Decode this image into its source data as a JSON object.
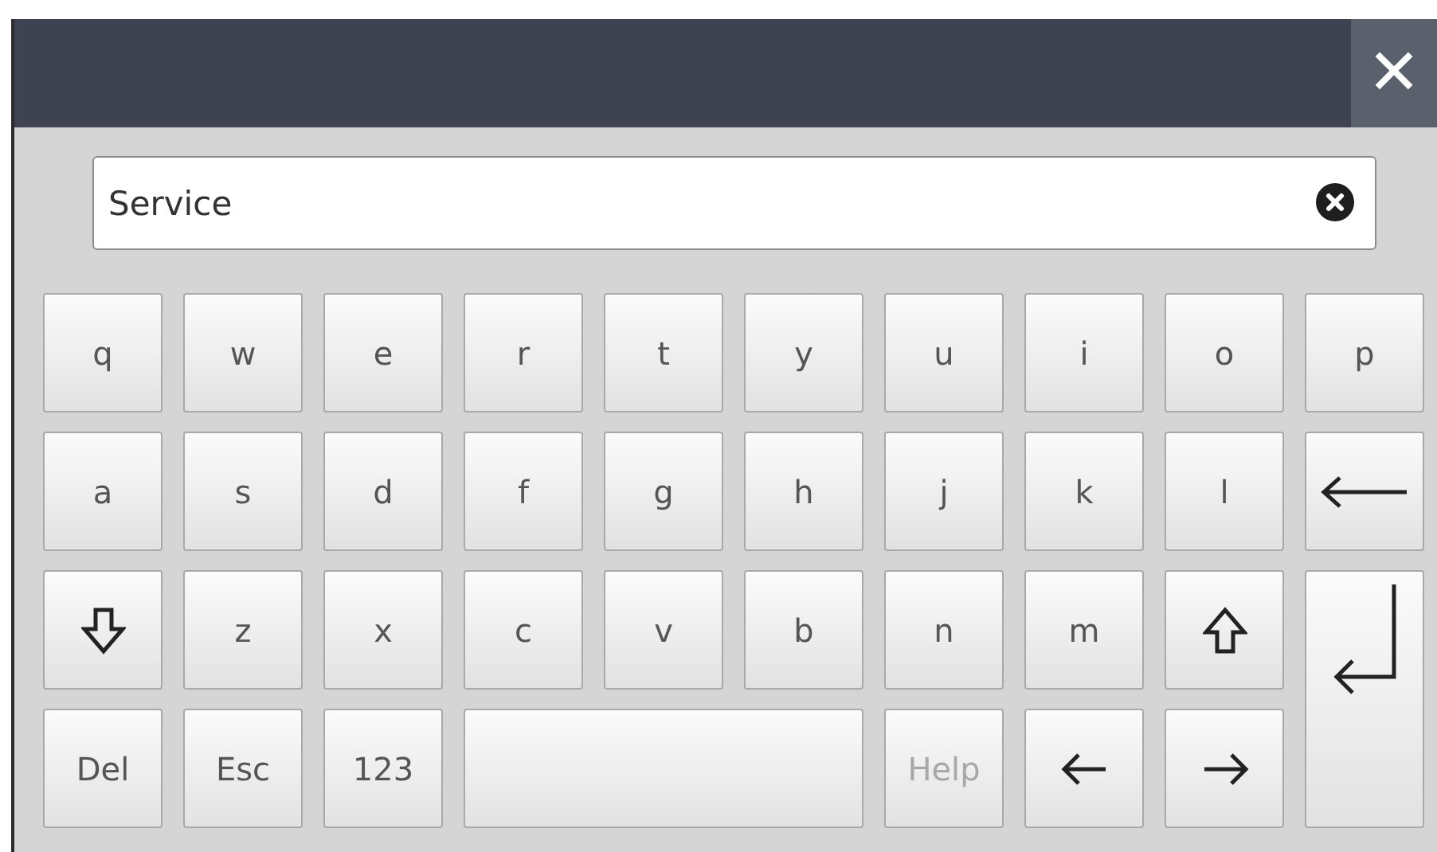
{
  "dialog": {
    "close": "✕"
  },
  "input": {
    "value": "Service"
  },
  "keys": [
    {
      "kind": "char",
      "label": "q",
      "disabled": false
    },
    {
      "kind": "char",
      "label": "w",
      "disabled": false
    },
    {
      "kind": "char",
      "label": "e",
      "disabled": false
    },
    {
      "kind": "char",
      "label": "r",
      "disabled": false
    },
    {
      "kind": "char",
      "label": "t",
      "disabled": false
    },
    {
      "kind": "char",
      "label": "y",
      "disabled": false
    },
    {
      "kind": "char",
      "label": "u",
      "disabled": false
    },
    {
      "kind": "char",
      "label": "i",
      "disabled": false
    },
    {
      "kind": "char",
      "label": "o",
      "disabled": false
    },
    {
      "kind": "char",
      "label": "p",
      "disabled": false
    },
    {
      "kind": "char",
      "label": "a",
      "disabled": false
    },
    {
      "kind": "char",
      "label": "s",
      "disabled": false
    },
    {
      "kind": "char",
      "label": "d",
      "disabled": false
    },
    {
      "kind": "char",
      "label": "f",
      "disabled": false
    },
    {
      "kind": "char",
      "label": "g",
      "disabled": false
    },
    {
      "kind": "char",
      "label": "h",
      "disabled": false
    },
    {
      "kind": "char",
      "label": "j",
      "disabled": false
    },
    {
      "kind": "char",
      "label": "k",
      "disabled": false
    },
    {
      "kind": "char",
      "label": "l",
      "disabled": false
    },
    {
      "kind": "backspace",
      "disabled": false
    },
    {
      "kind": "shift-down",
      "disabled": false
    },
    {
      "kind": "char",
      "label": "z",
      "disabled": false
    },
    {
      "kind": "char",
      "label": "x",
      "disabled": false
    },
    {
      "kind": "char",
      "label": "c",
      "disabled": false
    },
    {
      "kind": "char",
      "label": "v",
      "disabled": false
    },
    {
      "kind": "char",
      "label": "b",
      "disabled": false
    },
    {
      "kind": "char",
      "label": "n",
      "disabled": false
    },
    {
      "kind": "char",
      "label": "m",
      "disabled": false
    },
    {
      "kind": "shift-up",
      "disabled": false
    },
    {
      "kind": "enter",
      "disabled": false
    },
    {
      "kind": "char",
      "label": "Del",
      "disabled": false
    },
    {
      "kind": "char",
      "label": "Esc",
      "disabled": false
    },
    {
      "kind": "char",
      "label": "123",
      "disabled": false
    },
    {
      "kind": "space",
      "disabled": false
    },
    {
      "kind": "char",
      "label": "Help",
      "disabled": true
    },
    {
      "kind": "left",
      "disabled": false
    },
    {
      "kind": "right",
      "disabled": false
    }
  ]
}
